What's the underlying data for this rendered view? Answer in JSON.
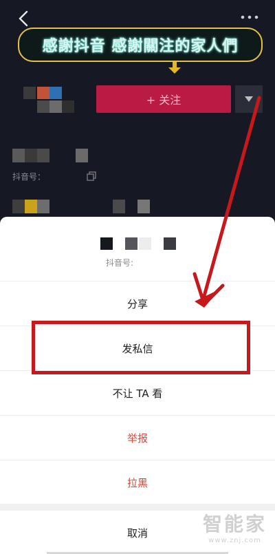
{
  "banner": {
    "text": "感謝抖音 感謝關注的家人們"
  },
  "profile": {
    "follow_label": "+ 关注",
    "id_label": "抖音号："
  },
  "sheet": {
    "id_label": "抖音号:",
    "items": [
      {
        "label": "分享",
        "style": "normal"
      },
      {
        "label": "发私信",
        "style": "normal"
      },
      {
        "label": "不让 TA 看",
        "style": "normal"
      },
      {
        "label": "举报",
        "style": "danger"
      },
      {
        "label": "拉黑",
        "style": "danger"
      }
    ],
    "cancel_label": "取消"
  },
  "watermark": {
    "title": "智能家",
    "url": "www.znj.com"
  },
  "colors": {
    "follow": "#b91b45",
    "danger": "#d3483a",
    "highlight": "#c7181c"
  }
}
